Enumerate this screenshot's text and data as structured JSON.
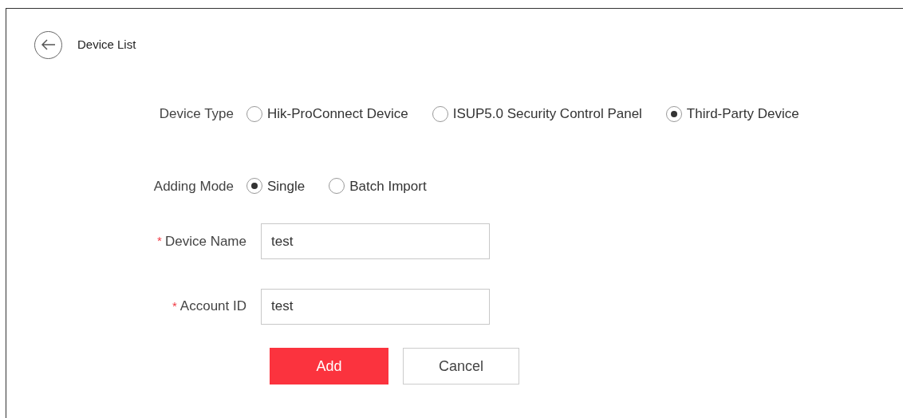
{
  "header": {
    "title": "Device List"
  },
  "form": [
    {
      "kind": "radio",
      "label": "Device Type",
      "options": [
        {
          "label": "Hik-ProConnect Device",
          "selected": false
        },
        {
          "label": "ISUP5.0 Security Control Panel",
          "selected": false
        },
        {
          "label": "Third-Party Device",
          "selected": true
        }
      ]
    },
    {
      "kind": "radio",
      "label": "Adding Mode",
      "options": [
        {
          "label": "Single",
          "selected": true
        },
        {
          "label": "Batch Import",
          "selected": false
        }
      ]
    },
    {
      "kind": "text",
      "label": "Device Name",
      "required_mark": "*",
      "value": "test"
    },
    {
      "kind": "text",
      "label": "Account ID",
      "required_mark": "*",
      "value": "test"
    }
  ],
  "buttons": [
    {
      "label": "Add",
      "kind": "primary"
    },
    {
      "label": "Cancel",
      "kind": "secondary"
    }
  ]
}
